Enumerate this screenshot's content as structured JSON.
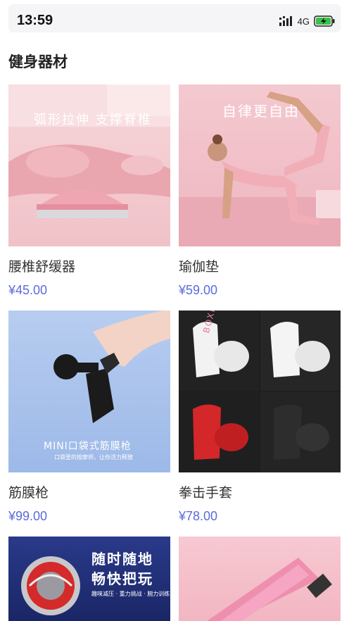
{
  "status_bar": {
    "time": "13:59",
    "network": "4G",
    "battery_color": "#3ac14a"
  },
  "section": {
    "title": "健身器材"
  },
  "products": [
    {
      "name": "腰椎舒缓器",
      "price": "¥45.00",
      "overlay": "弧形拉伸 支撑脊椎",
      "icon": "lumbar-stretcher"
    },
    {
      "name": "瑜伽垫",
      "price": "¥59.00",
      "overlay": "自律更自由",
      "icon": "yoga-pose"
    },
    {
      "name": "筋膜枪",
      "price": "¥99.00",
      "overlay": "MINI口袋式筋膜枪",
      "sub_overlay": "口袋里的按摩师，让你活力释放",
      "icon": "massage-gun"
    },
    {
      "name": "拳击手套",
      "price": "¥78.00",
      "overlay": "BOXING",
      "icon": "boxing-gloves"
    },
    {
      "name": "",
      "price": "",
      "overlay": "随时随地",
      "overlay2": "畅快把玩",
      "sub_overlay": "趣味减压 · 重力挑战 · 腕力训练",
      "icon": "wrist-ball"
    },
    {
      "name": "",
      "price": "",
      "overlay": "",
      "icon": "foam-roller"
    }
  ],
  "colors": {
    "price": "#5a6cdc",
    "pink_bg": "#f3c5cc",
    "blue_bg": "#a9c2eb",
    "dark_bg": "#202020",
    "navy_bg": "#1e2a6e"
  }
}
